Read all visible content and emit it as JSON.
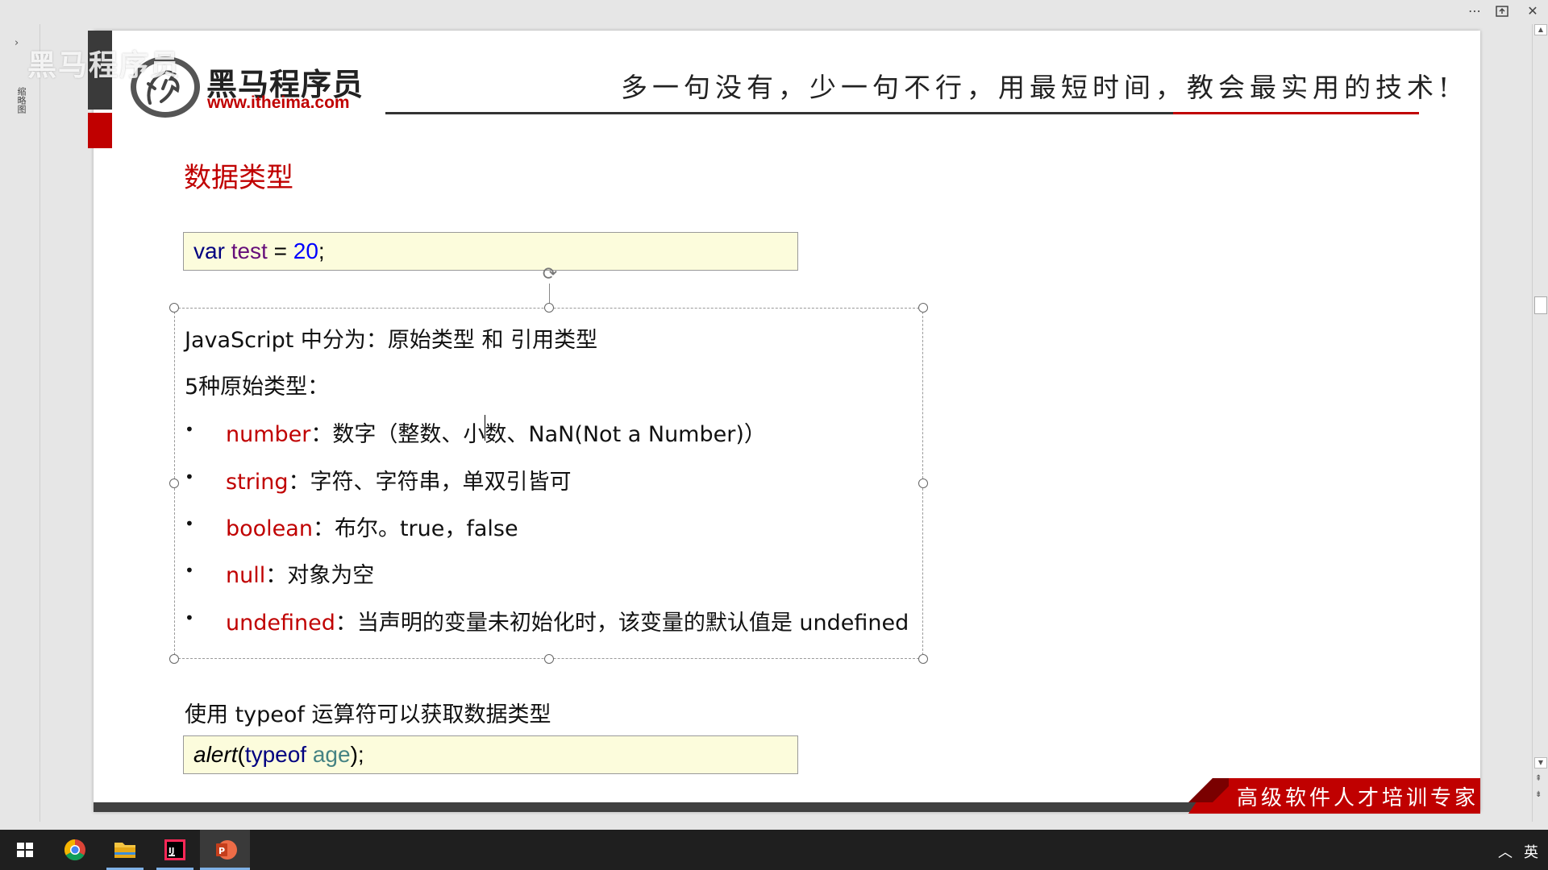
{
  "watermark": "黑马程序员",
  "left_panel": {
    "label": "缩略图"
  },
  "brand": {
    "name": "黑马程序员",
    "url": "www.itheima.com"
  },
  "slogan": "多一句没有，少一句不行，用最短时间，教会最实用的技术!",
  "slide_title": "数据类型",
  "code1": {
    "kw": "var",
    "name": "test",
    "op": "=",
    "num": "20",
    "end": ";"
  },
  "body": {
    "intro": "JavaScript 中分为：原始类型 和 引用类型",
    "count": "5种原始类型：",
    "bullet": "•",
    "items": [
      {
        "key": "number",
        "desc": "：数字（整数、小数、NaN(Not a Number)）"
      },
      {
        "key": "string",
        "desc": "：字符、字符串，单双引皆可"
      },
      {
        "key": "boolean",
        "desc": "：布尔。true，false"
      },
      {
        "key": "null",
        "desc": "：对象为空"
      },
      {
        "key": "undefined",
        "desc": "：当声明的变量未初始化时，该变量的默认值是 undefined"
      }
    ]
  },
  "typeof_note": "使用 typeof 运算符可以获取数据类型",
  "code2": {
    "fn": "alert",
    "open": "(",
    "kw": "typeof",
    "arg": "age",
    "close": ");"
  },
  "tagline": "高级软件人才培训专家",
  "taskbar": {
    "apps": [
      "chrome-icon",
      "file-explorer-icon",
      "intellij-icon",
      "powerpoint-icon"
    ],
    "ime": "英"
  }
}
